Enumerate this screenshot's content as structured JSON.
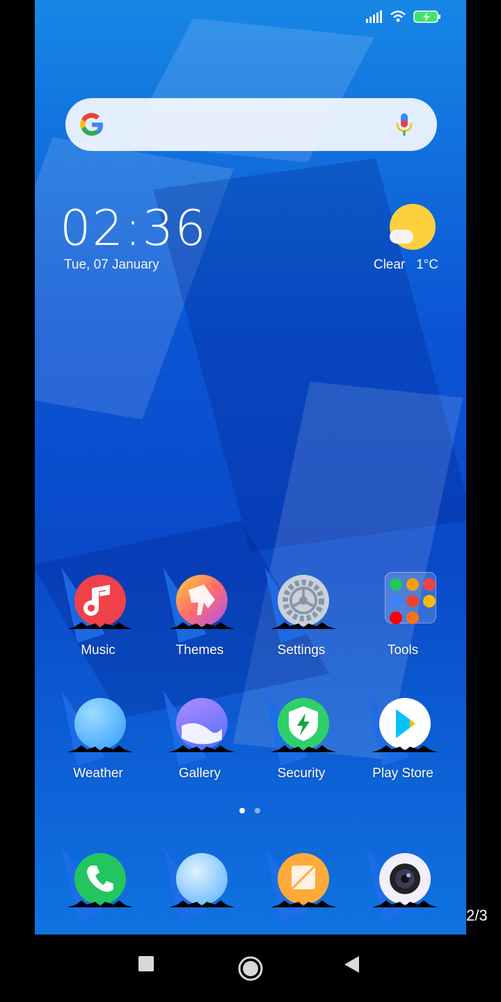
{
  "status_bar": {
    "icons": [
      "signal-icon",
      "wifi-icon",
      "battery-charging-icon"
    ]
  },
  "search_bar": {
    "icons": [
      "google-icon",
      "microphone-icon"
    ]
  },
  "clock": {
    "time": "02:36",
    "date": "Tue, 07 January"
  },
  "weather_widget": {
    "condition": "Clear",
    "temperature": "1°C",
    "icon": "sun-cloud-icon"
  },
  "apps_row1": [
    {
      "label": "Music",
      "icon": "music-icon",
      "color": "#f0414a"
    },
    {
      "label": "Themes",
      "icon": "themes-brush-icon",
      "color": "#ff7a59"
    },
    {
      "label": "Settings",
      "icon": "gear-icon",
      "color": "#a9b4c4"
    },
    {
      "label": "Tools",
      "icon": "folder-icon",
      "color": "#ffffff"
    }
  ],
  "apps_row2": [
    {
      "label": "Weather",
      "icon": "weather-icon",
      "color": "#4bb8ff"
    },
    {
      "label": "Gallery",
      "icon": "gallery-icon",
      "color": "#6f7cff"
    },
    {
      "label": "Security",
      "icon": "shield-bolt-icon",
      "color": "#2fcf6a"
    },
    {
      "label": "Play Store",
      "icon": "play-store-icon",
      "color": "#ffffff"
    }
  ],
  "dock": [
    {
      "icon": "phone-icon",
      "color": "#22c55e"
    },
    {
      "icon": "browser-icon",
      "color": "#52b0ff"
    },
    {
      "icon": "notes-icon",
      "color": "#ffaa3b"
    },
    {
      "icon": "camera-icon",
      "color": "#f7f0ff"
    }
  ],
  "page_indicator": {
    "pages": 2,
    "current": 1
  },
  "counter": "2/3",
  "navigation_bar": {
    "buttons": [
      "recents-square-icon",
      "home-circle-icon",
      "back-triangle-icon"
    ]
  }
}
